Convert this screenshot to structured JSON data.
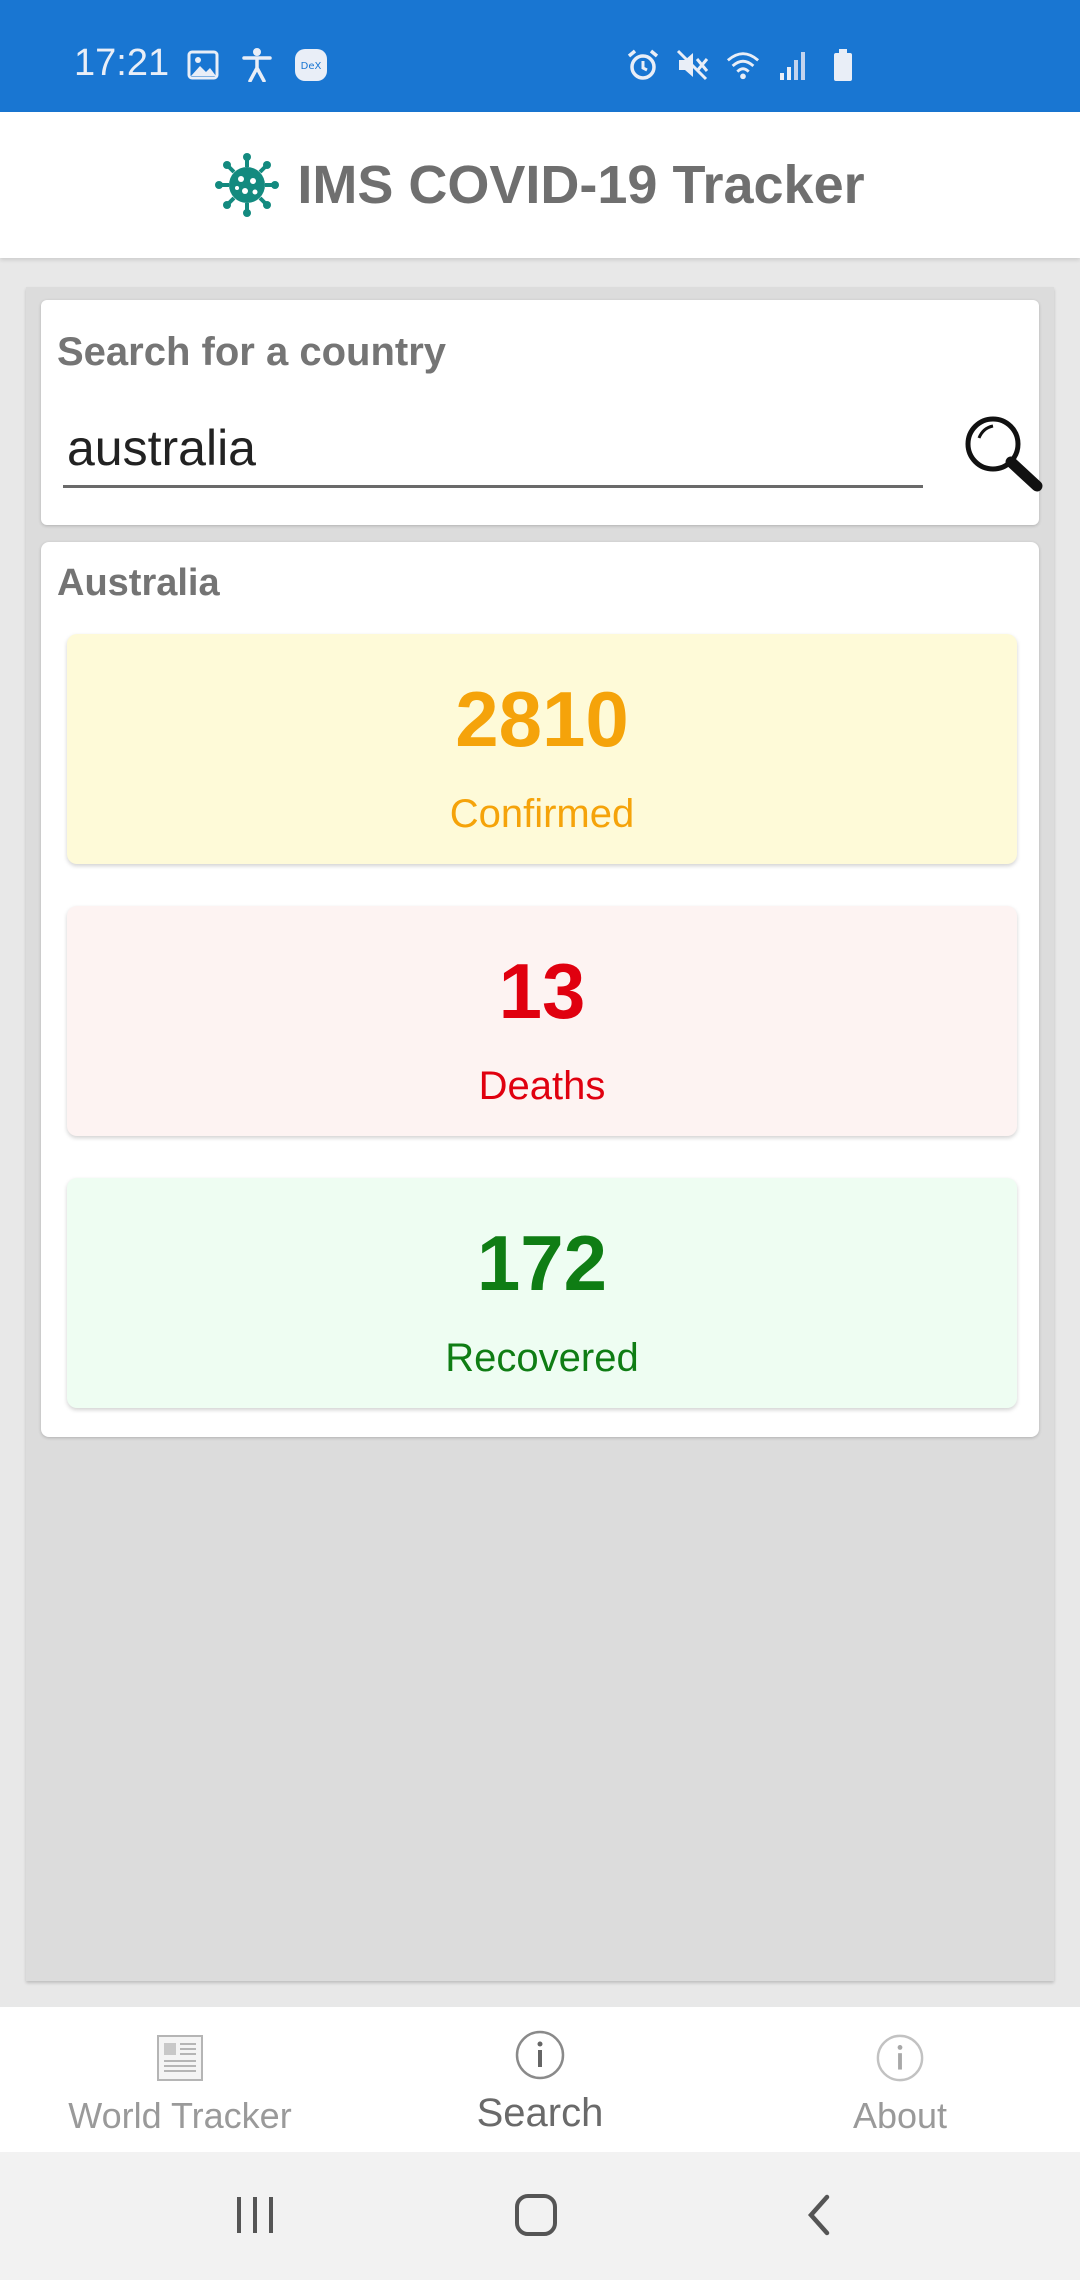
{
  "status_bar": {
    "time": "17:21",
    "left_icons": [
      "image-icon",
      "accessibility-icon",
      "dex-icon"
    ],
    "dex_badge": "DeX",
    "right_icons": [
      "alarm-icon",
      "mute-icon",
      "wifi-icon",
      "signal-icon",
      "battery-icon"
    ]
  },
  "header": {
    "logo_icon": "virus-icon",
    "title": "IMS COVID-19 Tracker",
    "logo_color": "#138a7f"
  },
  "search": {
    "label": "Search for a country",
    "value": "australia",
    "button_icon": "search-icon"
  },
  "result": {
    "country": "Australia",
    "stats": [
      {
        "value": "2810",
        "label": "Confirmed",
        "color": "#f5a30a",
        "bg": "#fefad8"
      },
      {
        "value": "13",
        "label": "Deaths",
        "color": "#e0000f",
        "bg": "#fdf3f2"
      },
      {
        "value": "172",
        "label": "Recovered",
        "color": "#0f7d14",
        "bg": "#eefdf2"
      }
    ]
  },
  "bottom_nav": {
    "items": [
      {
        "label": "World Tracker",
        "icon": "newspaper-icon",
        "active": false
      },
      {
        "label": "Search",
        "icon": "info-icon",
        "active": true
      },
      {
        "label": "About",
        "icon": "info-icon",
        "active": false
      }
    ]
  },
  "system_nav": [
    "recents-icon",
    "home-icon",
    "back-icon"
  ]
}
